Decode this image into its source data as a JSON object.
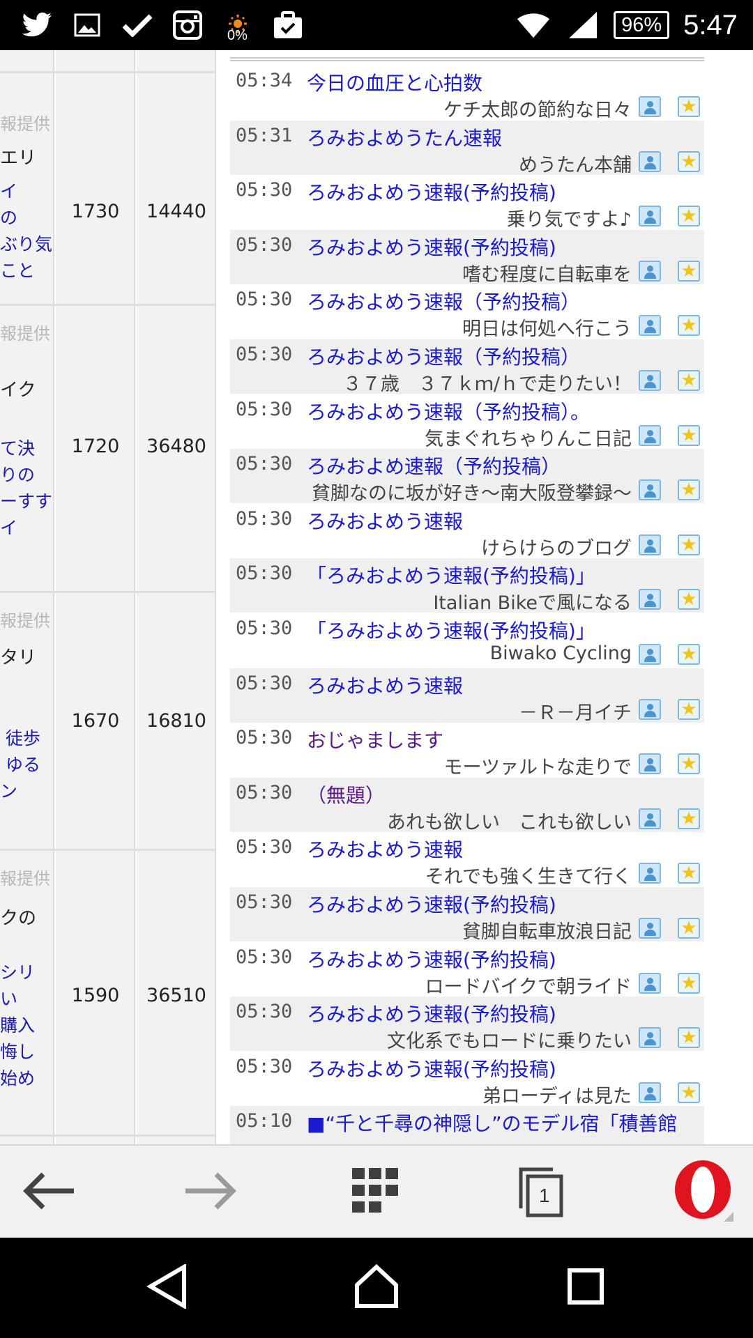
{
  "status_bar": {
    "time": "5:47",
    "battery": "96%",
    "sensor_percent": "0%",
    "left_icons": [
      "twitter-icon",
      "image-icon",
      "check-icon",
      "instagram-icon",
      "brightness-icon",
      "briefcase-check-icon"
    ],
    "right_icons": [
      "wifi-icon",
      "signal-icon"
    ]
  },
  "ranking_table": {
    "rows": [
      {
        "provider": "報提供",
        "lines": [
          "エリ"
        ],
        "links": [
          "イ",
          "の",
          "ぶり気",
          "こと"
        ],
        "col1": "1730",
        "col2": "14440"
      },
      {
        "provider": "報提供",
        "lines": [
          "イク"
        ],
        "links": [
          "て決",
          "りの",
          "ーすす",
          "イ"
        ],
        "col1": "1720",
        "col2": "36480"
      },
      {
        "provider": "報提供",
        "lines": [
          "タリ"
        ],
        "links": [
          "徒歩",
          "ゆる",
          "ン"
        ],
        "col1": "1670",
        "col2": "16810"
      },
      {
        "provider": "報提供",
        "lines": [
          "クの"
        ],
        "links": [
          "シリ",
          "い",
          "購入",
          "悔し",
          "始め"
        ],
        "col1": "1590",
        "col2": "36510"
      }
    ]
  },
  "feed": {
    "items": [
      {
        "time": "05:34",
        "title": "今日の血圧と心拍数",
        "blog": "ケチ太郎の節約な日々",
        "visited": false
      },
      {
        "time": "05:31",
        "title": "ろみおよめうたん速報",
        "blog": "めうたん本舗",
        "visited": false
      },
      {
        "time": "05:30",
        "title": "ろみおよめう速報(予約投稿)",
        "blog": "乗り気ですよ♪",
        "visited": false
      },
      {
        "time": "05:30",
        "title": "ろみおよめう速報(予約投稿)",
        "blog": "嗜む程度に自転車を",
        "visited": false
      },
      {
        "time": "05:30",
        "title": "ろみおよめう速報（予約投稿）",
        "blog": "明日は何処へ行こう",
        "visited": false
      },
      {
        "time": "05:30",
        "title": "ろみおよめう速報（予約投稿）",
        "blog": "３７歳　３７ｋｍ/ｈで走りたい！",
        "visited": false
      },
      {
        "time": "05:30",
        "title": "ろみおよめう速報（予約投稿）。",
        "blog": "気まぐれちゃりんこ日記",
        "visited": false
      },
      {
        "time": "05:30",
        "title": "ろみおよめ速報（予約投稿）",
        "blog": "貧脚なのに坂が好き〜南大阪登攀録〜",
        "visited": false
      },
      {
        "time": "05:30",
        "title": "ろみおよめう速報",
        "blog": "けらけらのブログ",
        "visited": false
      },
      {
        "time": "05:30",
        "title": "「ろみおよめう速報(予約投稿)」",
        "blog": "Italian Bikeで風になる",
        "visited": false
      },
      {
        "time": "05:30",
        "title": "「ろみおよめう速報(予約投稿)」",
        "blog": "Biwako Cycling",
        "visited": false
      },
      {
        "time": "05:30",
        "title": "ろみおよめう速報",
        "blog": "－Ｒ－月イチ",
        "visited": false
      },
      {
        "time": "05:30",
        "title": "おじゃまします",
        "blog": "モーツァルトな走りで",
        "visited": true
      },
      {
        "time": "05:30",
        "title": "（無題）",
        "blog": "あれも欲しい　これも欲しい",
        "visited": true
      },
      {
        "time": "05:30",
        "title": "ろみおよめう速報",
        "blog": "それでも強く生きて行く",
        "visited": false
      },
      {
        "time": "05:30",
        "title": "ろみおよめう速報(予約投稿)",
        "blog": "貧脚自転車放浪日記",
        "visited": false
      },
      {
        "time": "05:30",
        "title": "ろみおよめう速報(予約投稿)",
        "blog": "ロードバイクで朝ライド",
        "visited": false
      },
      {
        "time": "05:30",
        "title": "ろみおよめう速報(予約投稿)",
        "blog": "文化系でもロードに乗りたい",
        "visited": false
      },
      {
        "time": "05:30",
        "title": "ろみおよめう速報(予約投稿)",
        "blog": "弟ローディは見た",
        "visited": false
      },
      {
        "time": "05:10",
        "title": "■“千と千尋の神隠し”のモデル宿「積善館",
        "blog": "",
        "visited": false
      }
    ]
  },
  "browser_bar": {
    "tab_count": "1",
    "icons": [
      "back-arrow-icon",
      "forward-arrow-icon",
      "speed-dial-grid-icon",
      "tabs-icon",
      "opera-menu-icon"
    ]
  },
  "nav_bar": {
    "icons": [
      "nav-back-icon",
      "nav-home-icon",
      "nav-recents-icon"
    ]
  }
}
